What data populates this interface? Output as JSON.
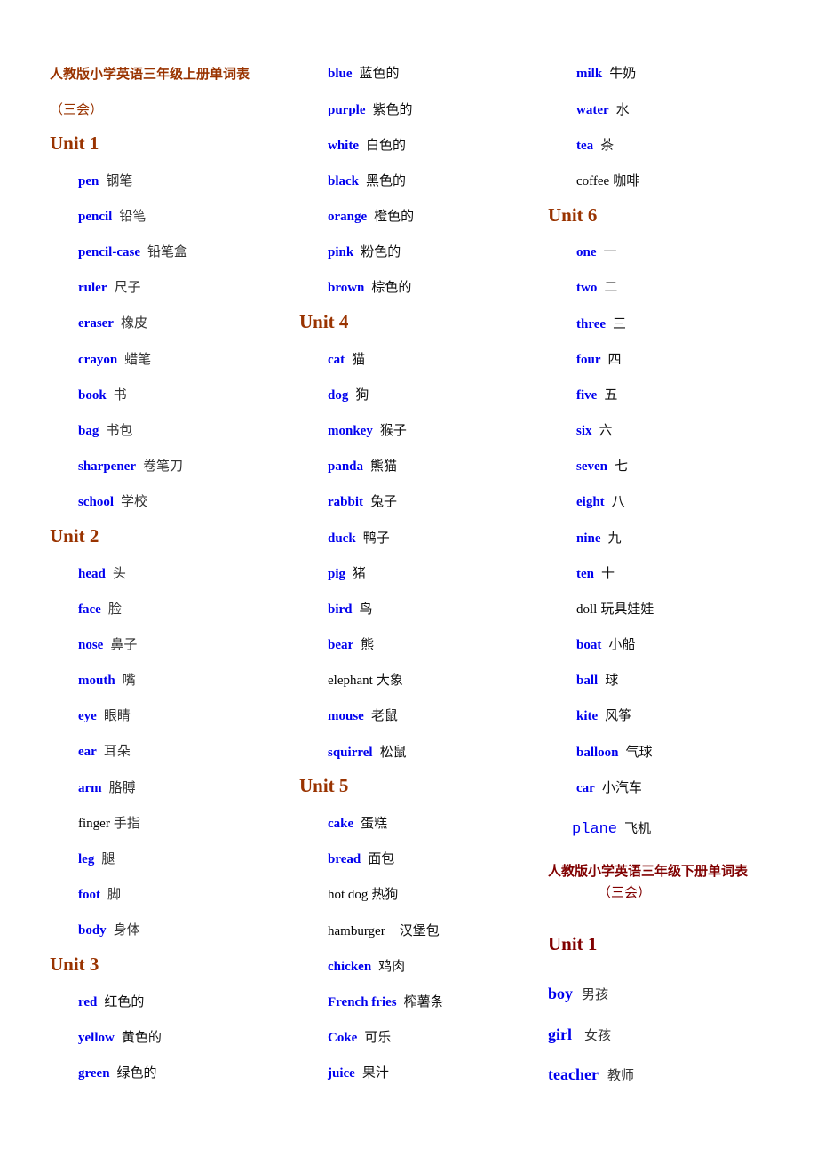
{
  "book1": {
    "title": "人教版小学英语三年级上册单词表",
    "subtitle": "（三会）",
    "units": [
      {
        "label": "Unit 1",
        "words": [
          {
            "en": "pen",
            "zh": "钢笔"
          },
          {
            "en": "pencil",
            "zh": "铅笔"
          },
          {
            "en": "pencil-case",
            "zh": "铅笔盒"
          },
          {
            "en": "ruler",
            "zh": "尺子"
          },
          {
            "en": "eraser",
            "zh": "橡皮"
          },
          {
            "en": "crayon",
            "zh": "蜡笔"
          },
          {
            "en": "book",
            "zh": "书"
          },
          {
            "en": "bag",
            "zh": "书包"
          },
          {
            "en": "sharpener",
            "zh": "卷笔刀"
          },
          {
            "en": "school",
            "zh": "学校"
          }
        ]
      },
      {
        "label": "Unit 2",
        "words": [
          {
            "en": "head",
            "zh": "头"
          },
          {
            "en": "face",
            "zh": "脸"
          },
          {
            "en": "nose",
            "zh": "鼻子"
          },
          {
            "en": "mouth",
            "zh": "嘴"
          },
          {
            "en": "eye",
            "zh": "眼睛"
          },
          {
            "en": "ear",
            "zh": "耳朵"
          },
          {
            "en": "arm",
            "zh": "胳膊"
          },
          {
            "en": "finger",
            "zh": "手指"
          },
          {
            "en": "leg",
            "zh": "腿"
          },
          {
            "en": "foot",
            "zh": "脚"
          },
          {
            "en": "body",
            "zh": "身体"
          }
        ]
      },
      {
        "label": "Unit 3",
        "words": [
          {
            "en": "red",
            "zh": "红色的"
          },
          {
            "en": "yellow",
            "zh": "黄色的"
          },
          {
            "en": "green",
            "zh": "绿色的"
          },
          {
            "en": "blue",
            "zh": "蓝色的"
          },
          {
            "en": "purple",
            "zh": "紫色的"
          },
          {
            "en": "white",
            "zh": "白色的"
          },
          {
            "en": "black",
            "zh": "黑色的"
          },
          {
            "en": "orange",
            "zh": "橙色的"
          },
          {
            "en": "pink",
            "zh": "粉色的"
          },
          {
            "en": "brown",
            "zh": "棕色的"
          }
        ]
      },
      {
        "label": "Unit 4",
        "words": [
          {
            "en": "cat",
            "zh": "猫"
          },
          {
            "en": "dog",
            "zh": "狗"
          },
          {
            "en": "monkey",
            "zh": "猴子"
          },
          {
            "en": "panda",
            "zh": "熊猫"
          },
          {
            "en": "rabbit",
            "zh": "兔子"
          },
          {
            "en": "duck",
            "zh": "鸭子"
          },
          {
            "en": "pig",
            "zh": "猪"
          },
          {
            "en": "bird",
            "zh": "鸟"
          },
          {
            "en": "bear",
            "zh": "熊"
          },
          {
            "en": "elephant",
            "zh": "大象"
          },
          {
            "en": "mouse",
            "zh": "老鼠"
          },
          {
            "en": "squirrel",
            "zh": "松鼠"
          }
        ]
      },
      {
        "label": "Unit 5",
        "words": [
          {
            "en": "cake",
            "zh": "蛋糕"
          },
          {
            "en": "bread",
            "zh": "面包"
          },
          {
            "en": "hot dog",
            "zh": "热狗"
          },
          {
            "en": "hamburger",
            "zh": "汉堡包"
          },
          {
            "en": "chicken",
            "zh": "鸡肉"
          },
          {
            "en": "French fries",
            "zh": "榨薯条"
          },
          {
            "en": "Coke",
            "zh": "可乐"
          },
          {
            "en": "juice",
            "zh": "果汁"
          },
          {
            "en": "milk",
            "zh": "牛奶"
          },
          {
            "en": "water",
            "zh": "水"
          },
          {
            "en": "tea",
            "zh": "茶"
          },
          {
            "en": "coffee",
            "zh": "咖啡"
          }
        ]
      },
      {
        "label": "Unit 6",
        "words": [
          {
            "en": "one",
            "zh": "一"
          },
          {
            "en": "two",
            "zh": "二"
          },
          {
            "en": "three",
            "zh": "三"
          },
          {
            "en": "four",
            "zh": "四"
          },
          {
            "en": "five",
            "zh": "五"
          },
          {
            "en": "six",
            "zh": "六"
          },
          {
            "en": "seven",
            "zh": "七"
          },
          {
            "en": "eight",
            "zh": "八"
          },
          {
            "en": "nine",
            "zh": "九"
          },
          {
            "en": "ten",
            "zh": "十"
          },
          {
            "en": "doll",
            "zh": "玩具娃娃"
          },
          {
            "en": "boat",
            "zh": "小船"
          },
          {
            "en": "ball",
            "zh": "球"
          },
          {
            "en": "kite",
            "zh": "风筝"
          },
          {
            "en": "balloon",
            "zh": "气球"
          },
          {
            "en": "car",
            "zh": "小汽车"
          },
          {
            "en": "plane",
            "zh": "飞机"
          }
        ]
      }
    ]
  },
  "book2": {
    "title": "人教版小学英语三年级下册单词表",
    "subtitle": "（三会）",
    "units": [
      {
        "label": "Unit  1",
        "words": [
          {
            "en": "boy",
            "zh": "男孩"
          },
          {
            "en": "girl",
            "zh": "女孩"
          },
          {
            "en": "teacher",
            "zh": "教师"
          }
        ]
      }
    ]
  },
  "colors": {
    "heading_brown": "#993300",
    "heading_maroon": "#800000",
    "word_blue": "#0000ee",
    "text_black": "#000000"
  }
}
